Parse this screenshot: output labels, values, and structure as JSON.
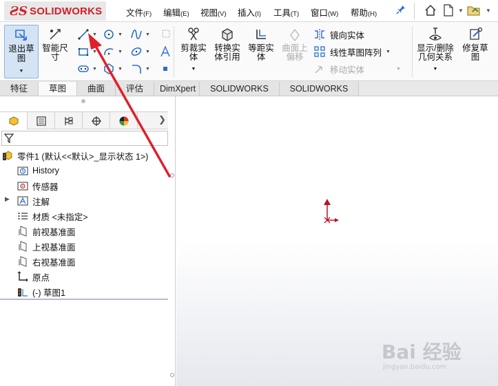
{
  "app": {
    "logo_mark": "ƧS",
    "logo_text": "SOLIDWORKS"
  },
  "menu": [
    {
      "label": "文件",
      "key": "(F)"
    },
    {
      "label": "编辑",
      "key": "(E)"
    },
    {
      "label": "视图",
      "key": "(V)"
    },
    {
      "label": "插入",
      "key": "(I)"
    },
    {
      "label": "工具",
      "key": "(T)"
    },
    {
      "label": "窗口",
      "key": "(W)"
    },
    {
      "label": "帮助",
      "key": "(H)"
    }
  ],
  "ribbon": {
    "exit_sketch": "退出草图",
    "smart_dimension": "智能尺寸",
    "trim": "剪裁实体",
    "convert": "转换实体引用",
    "offset": "等距实体",
    "surface_offset": "曲面上偏移",
    "mirror": "镜向实体",
    "linear_pattern": "线性草图阵列",
    "move": "移动实体",
    "display_delete": "显示/删除几何关系",
    "repair": "修复草图"
  },
  "tabs": [
    "特征",
    "草图",
    "曲面",
    "评估",
    "DimXpert",
    "SOLIDWORKS 插件",
    "SOLIDWORKS MBD"
  ],
  "tree": {
    "part": "零件1  (默认<<默认>_显示状态 1>)",
    "history": "History",
    "sensors": "传感器",
    "annotations": "注解",
    "material": "材质 <未指定>",
    "front_plane": "前视基准面",
    "top_plane": "上视基准面",
    "right_plane": "右视基准面",
    "origin": "原点",
    "sketch": "(-) 草图1"
  },
  "watermark": {
    "brand": "Bai 经验",
    "url": "jingyan.baidu.com"
  },
  "colors": {
    "brand_red": "#d0202a",
    "active_btn": "#d4e4f4",
    "arrow_red": "#e0202a"
  }
}
